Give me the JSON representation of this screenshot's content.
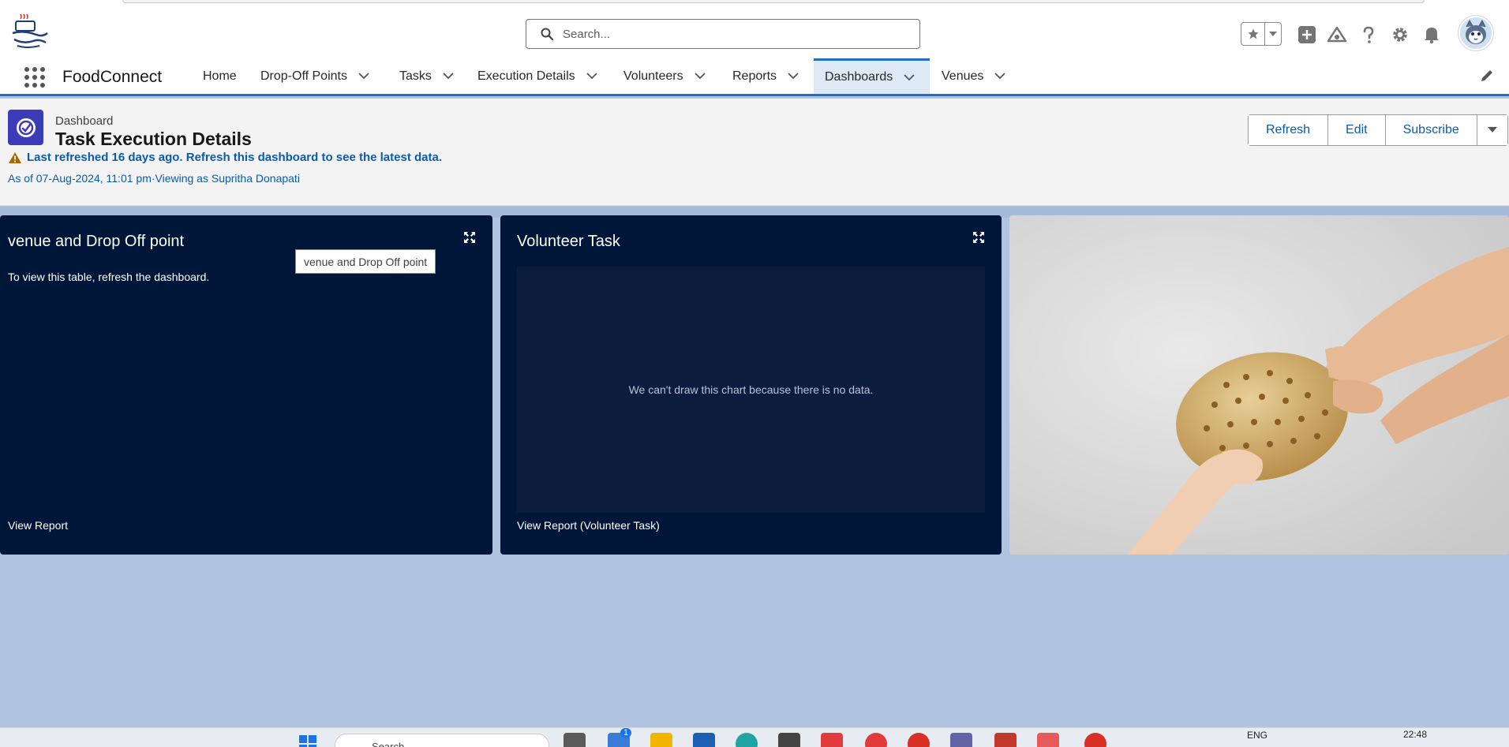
{
  "header": {
    "search_placeholder": "Search...",
    "icons": [
      "favorites-star-icon",
      "favorites-dropdown-icon",
      "global-actions-icon",
      "trailhead-icon",
      "help-icon",
      "setup-gear-icon",
      "notifications-bell-icon",
      "user-avatar"
    ]
  },
  "nav": {
    "app_name": "FoodConnect",
    "items": [
      {
        "label": "Home",
        "has_menu": false
      },
      {
        "label": "Drop-Off Points",
        "has_menu": true
      },
      {
        "label": "Tasks",
        "has_menu": true
      },
      {
        "label": "Execution Details",
        "has_menu": true
      },
      {
        "label": "Volunteers",
        "has_menu": true
      },
      {
        "label": "Reports",
        "has_menu": true
      },
      {
        "label": "Dashboards",
        "has_menu": true,
        "active": true
      },
      {
        "label": "Venues",
        "has_menu": true
      }
    ]
  },
  "dashboard": {
    "eyebrow": "Dashboard",
    "title": "Task Execution Details",
    "warning": "Last refreshed 16 days ago. Refresh this dashboard to see the latest data.",
    "as_of": "As of 07-Aug-2024, 11:01 pm·Viewing as Supritha Donapati",
    "buttons": {
      "refresh": "Refresh",
      "edit": "Edit",
      "subscribe": "Subscribe"
    }
  },
  "widgets": {
    "venue": {
      "title": "venue and Drop Off point",
      "message": "To view this table, refresh the dashboard.",
      "tooltip": "venue and Drop Off point",
      "footer": "View Report"
    },
    "volunteer": {
      "title": "Volunteer Task",
      "message": "We can't draw this chart because there is no data.",
      "footer": "View Report (Volunteer Task)"
    },
    "image": {
      "subject": "hands sharing a seeded bread roll"
    }
  },
  "taskbar": {
    "search_placeholder": "Search",
    "badge_count": "1",
    "language": "ENG",
    "time": "22:48"
  },
  "colors": {
    "brand_blue": "#1b6fc8",
    "link_blue": "#0b5cab",
    "widget_bg": "#001639",
    "canvas_bg": "#b0c4df",
    "dashboard_icon": "#3c3cb8",
    "warning": "#a96404"
  }
}
